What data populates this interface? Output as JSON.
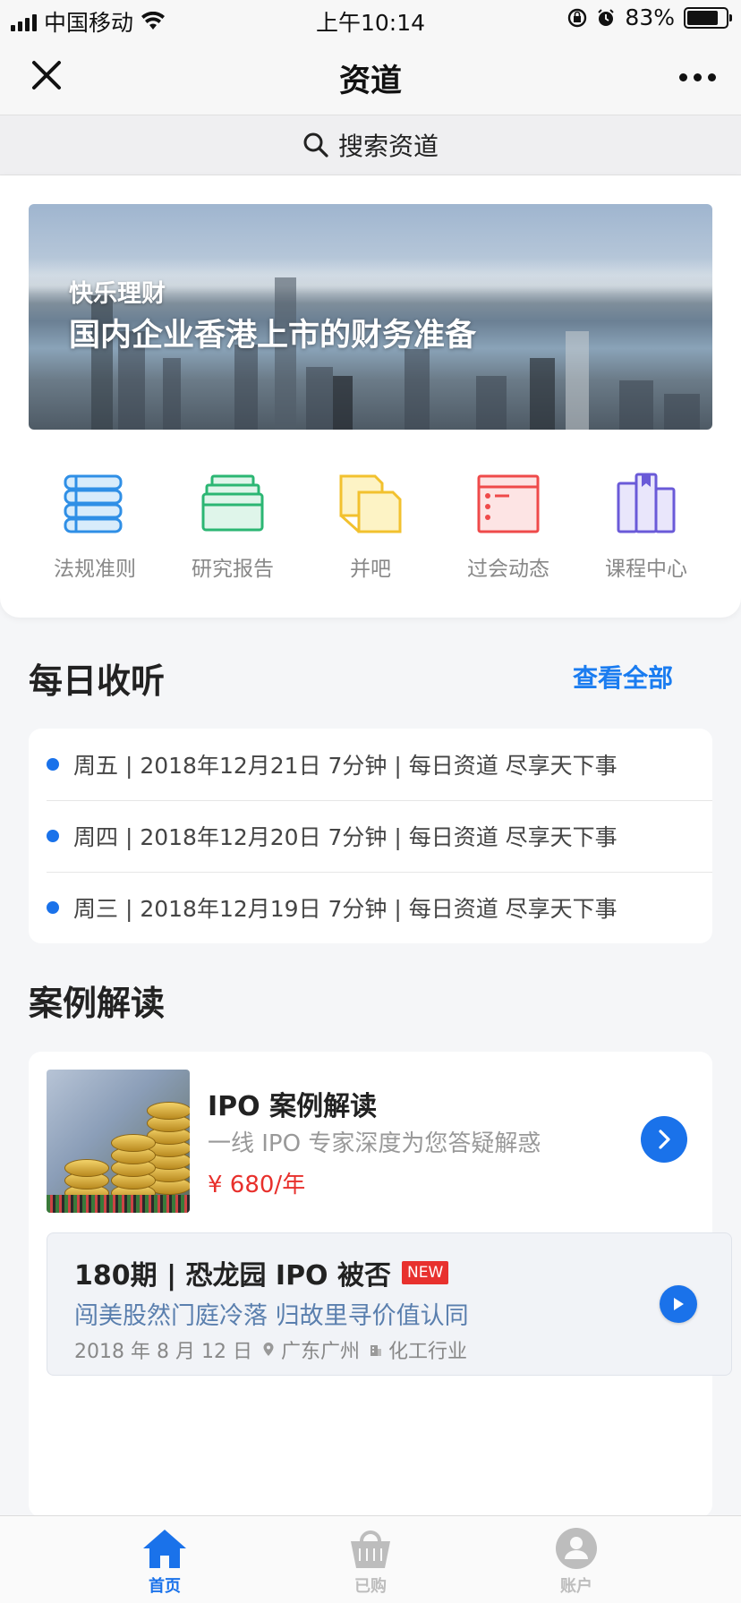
{
  "status_bar": {
    "carrier": "中国移动",
    "time": "上午10:14",
    "battery_percent": "83%"
  },
  "nav": {
    "title": "资道"
  },
  "search": {
    "placeholder": "搜索资道"
  },
  "banner": {
    "subtitle": "快乐理财",
    "title": "国内企业香港上市的财务准备"
  },
  "categories": [
    {
      "label": "法规准则",
      "icon": "books-icon",
      "color": "#2f8fe6"
    },
    {
      "label": "研究报告",
      "icon": "folder-icon",
      "color": "#2bb673"
    },
    {
      "label": "并吧",
      "icon": "notes-icon",
      "color": "#f2c12e"
    },
    {
      "label": "过会动态",
      "icon": "calendar-window-icon",
      "color": "#ef4a4a"
    },
    {
      "label": "课程中心",
      "icon": "book-stack-icon",
      "color": "#6a5ad8"
    }
  ],
  "daily": {
    "heading": "每日收听",
    "view_all": "查看全部",
    "items": [
      {
        "text": "周五 | 2018年12月21日 7分钟 | 每日资道 尽享天下事"
      },
      {
        "text": "周四 | 2018年12月20日 7分钟 | 每日资道 尽享天下事"
      },
      {
        "text": "周三 | 2018年12月19日 7分钟 | 每日资道 尽享天下事"
      }
    ]
  },
  "cases": {
    "heading": "案例解读",
    "product": {
      "title": "IPO 案例解读",
      "description": "一线 IPO 专家深度为您答疑解惑",
      "price": "¥ 680/年"
    },
    "episode": {
      "title": "180期 | 恐龙园 IPO 被否",
      "badge": "NEW",
      "subtitle": "闯美股然门庭冷落 归故里寻价值认同",
      "date": "2018 年 8 月 12 日",
      "location": "广东广州",
      "industry": "化工行业"
    }
  },
  "tabbar": {
    "items": [
      {
        "label": "首页",
        "icon": "home-icon",
        "active": true
      },
      {
        "label": "已购",
        "icon": "shopping-basket-icon",
        "active": false
      },
      {
        "label": "账户",
        "icon": "user-icon",
        "active": false
      }
    ]
  },
  "colors": {
    "accent": "#1a72ea",
    "price": "#e8302c",
    "inactive_tab": "#bdbdbd"
  }
}
